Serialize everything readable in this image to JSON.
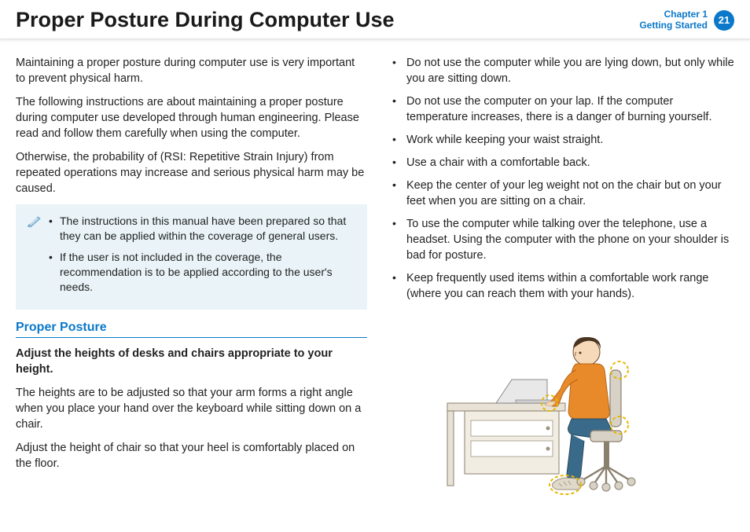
{
  "header": {
    "title": "Proper Posture During Computer Use",
    "chapter_label": "Chapter 1",
    "chapter_sub": "Getting Started",
    "page_num": "21"
  },
  "left": {
    "p1": "Maintaining a proper posture during computer use is very important to prevent physical harm.",
    "p2": "The following instructions are about maintaining a proper posture during computer use developed through human engineering. Please read and follow them carefully when using the computer.",
    "p3": "Otherwise, the probability of (RSI: Repetitive Strain Injury) from repeated operations may increase and serious physical harm may be caused.",
    "note": {
      "items": [
        "The instructions in this manual have been prepared so that they can be applied within the coverage of general users.",
        "If the user is not included in the coverage, the recommendation is to be applied according to the user's needs."
      ]
    },
    "section_head": "Proper Posture",
    "subhead": "Adjust the heights of desks and chairs appropriate to your height.",
    "p4": "The heights are to be adjusted so that your arm forms a right angle when you place your hand over the keyboard while sitting down on a chair.",
    "p5": "Adjust the height of chair so that your heel is comfortably placed on the floor."
  },
  "right": {
    "bullets": [
      "Do not use the computer while you are lying down, but only while you are sitting down.",
      "Do not use the computer on your lap. If the computer temperature increases, there is a danger of burning yourself.",
      "Work while keeping your waist straight.",
      "Use a chair with a comfortable back.",
      "Keep the center of your leg weight not on the chair but on your feet when you are sitting on a chair.",
      "To use the computer while talking over the telephone, use a headset. Using the computer with the phone on your shoulder is bad for posture.",
      "Keep frequently used items within a comfortable work range (where you can reach them with your hands)."
    ]
  }
}
